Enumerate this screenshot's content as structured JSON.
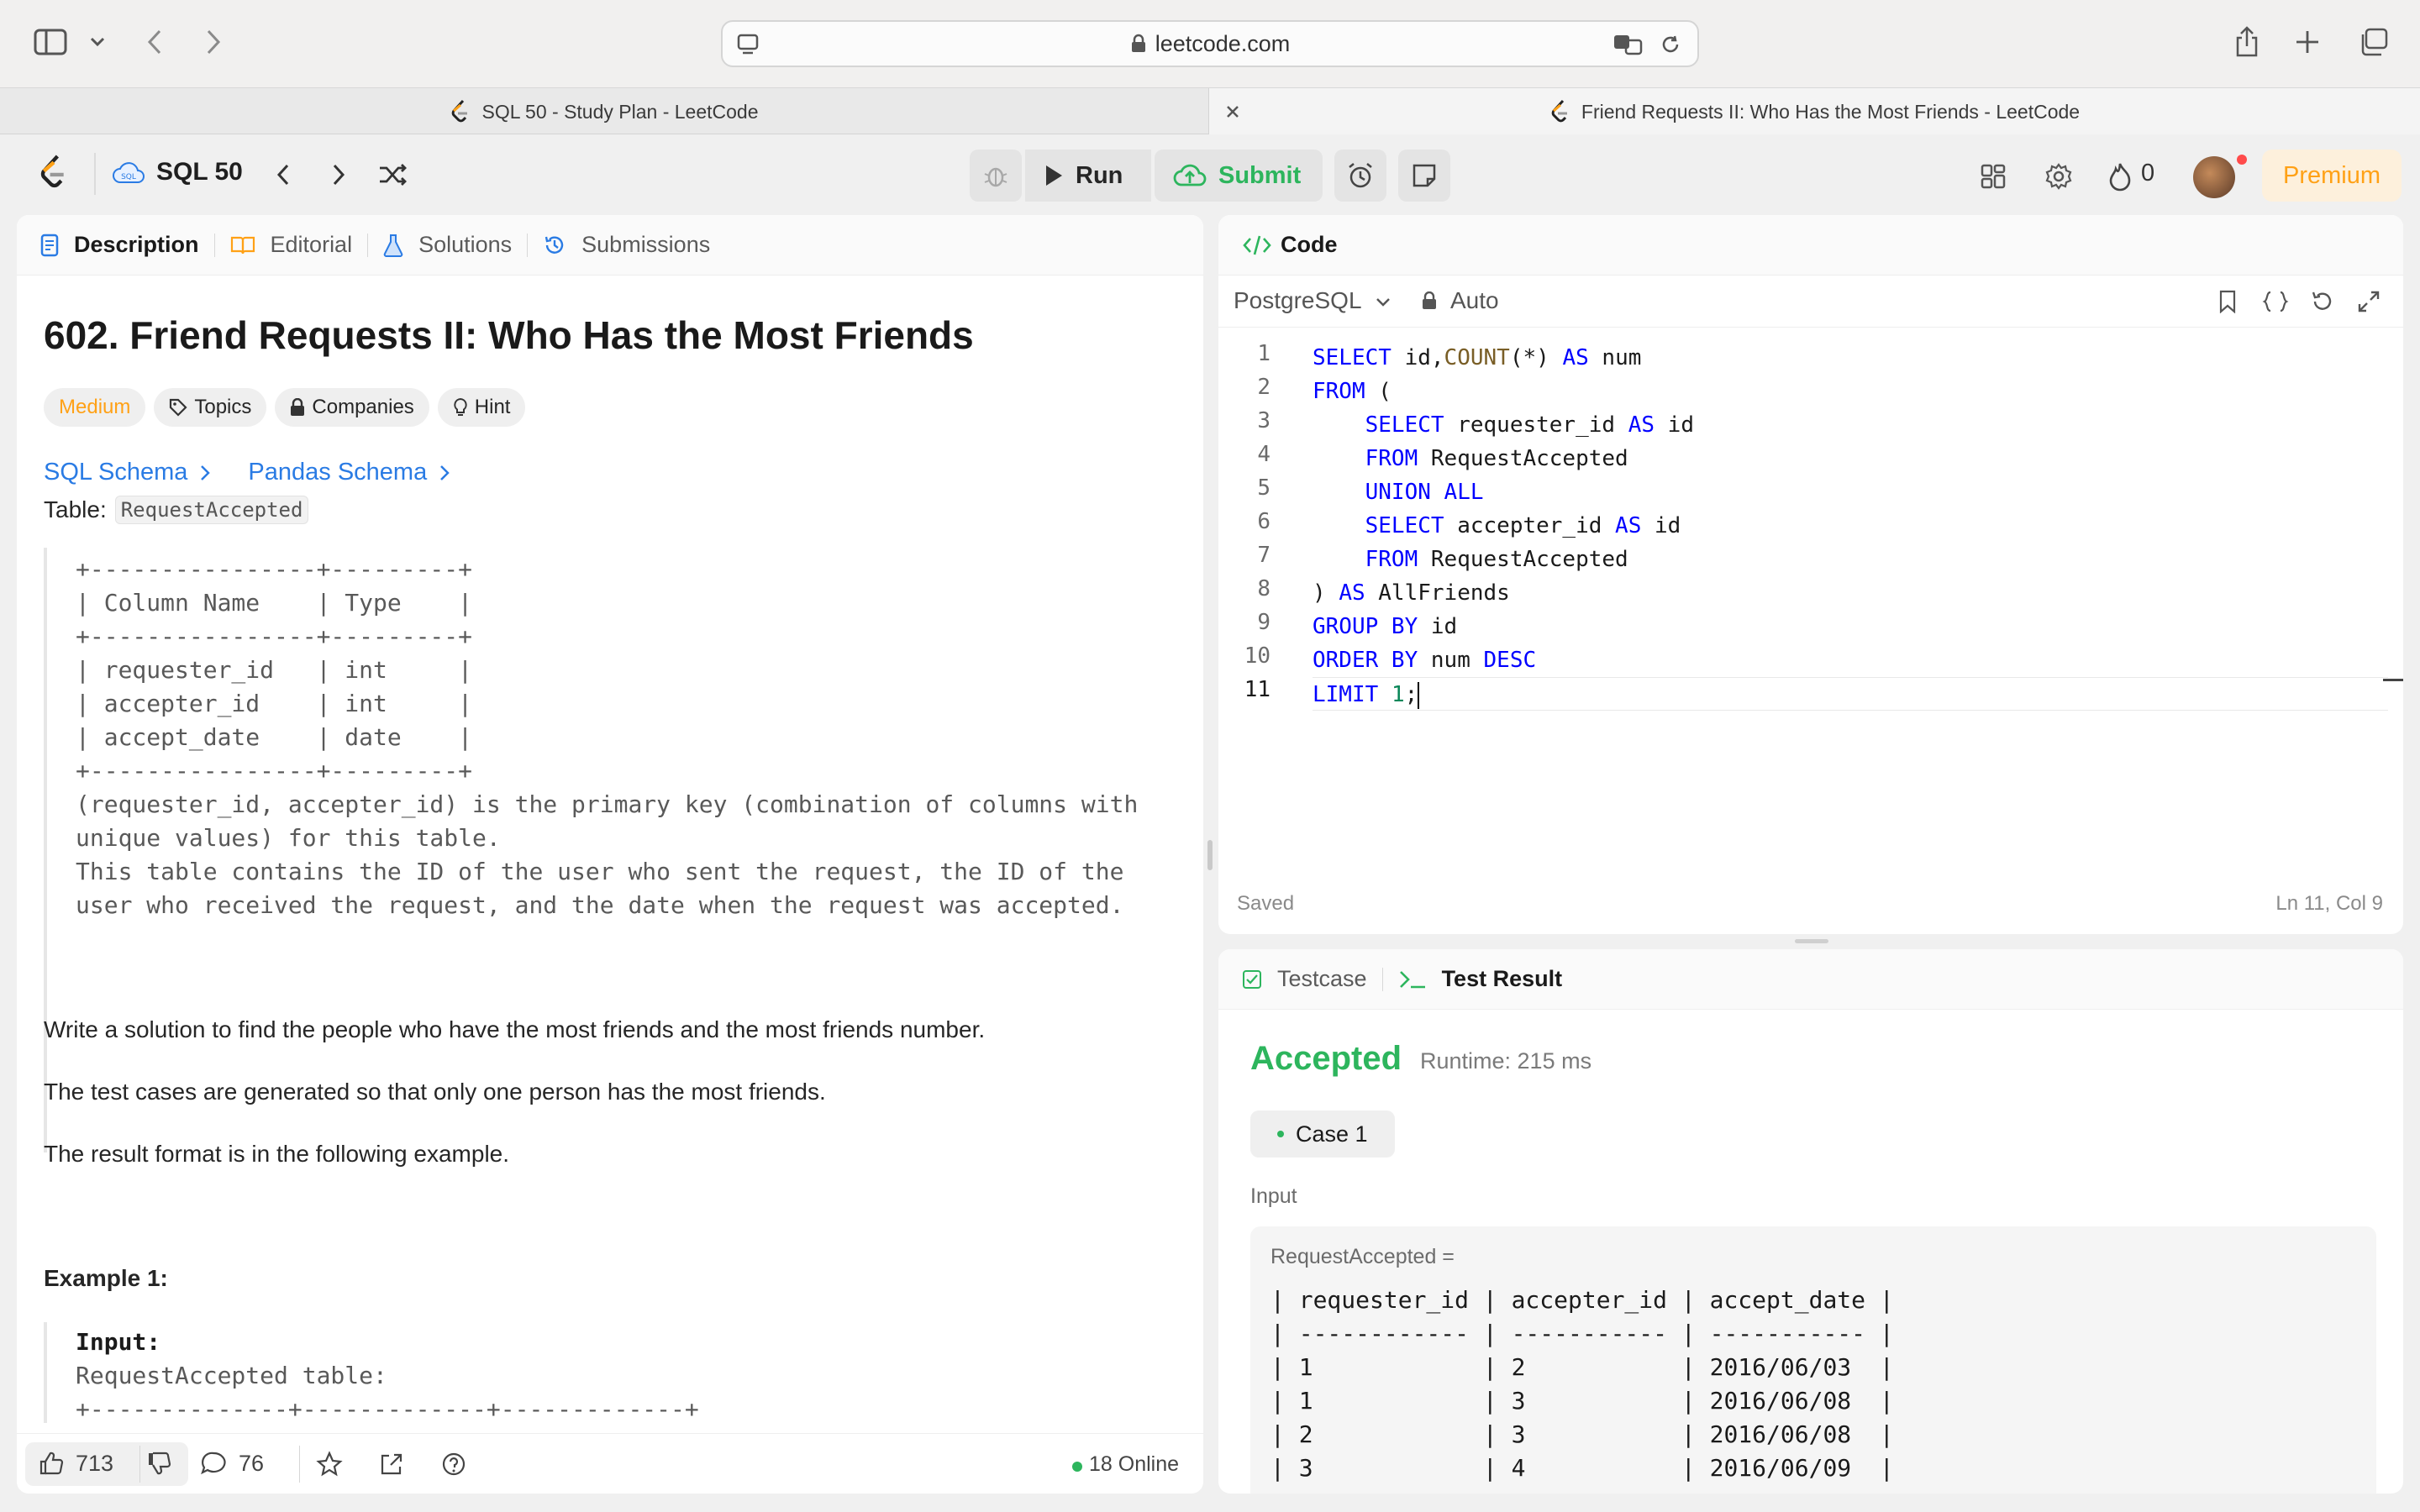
{
  "browser": {
    "url": "leetcode.com",
    "tabs": [
      {
        "title": "SQL 50 - Study Plan - LeetCode"
      },
      {
        "title": "Friend Requests II: Who Has the Most Friends - LeetCode"
      }
    ]
  },
  "nav": {
    "plan_name": "SQL 50",
    "run_label": "Run",
    "submit_label": "Submit",
    "streak_count": "0",
    "premium_label": "Premium"
  },
  "left_tabs": [
    "Description",
    "Editorial",
    "Solutions",
    "Submissions"
  ],
  "problem": {
    "title": "602. Friend Requests II: Who Has the Most Friends",
    "difficulty": "Medium",
    "chips": [
      "Topics",
      "Companies",
      "Hint"
    ],
    "schema_links": [
      "SQL Schema",
      "Pandas Schema"
    ],
    "table_label": "Table:",
    "table_name": "RequestAccepted",
    "schema_block": "+----------------+---------+\n| Column Name    | Type    |\n+----------------+---------+\n| requester_id   | int     |\n| accepter_id    | int     |\n| accept_date    | date    |\n+----------------+---------+\n(requester_id, accepter_id) is the primary key (combination of columns with\nunique values) for this table.\nThis table contains the ID of the user who sent the request, the ID of the\nuser who received the request, and the date when the request was accepted.",
    "paragraphs": [
      "Write a solution to find the people who have the most friends and the most friends number.",
      "The test cases are generated so that only one person has the most friends.",
      "The result format is in the following example."
    ],
    "example_heading": "Example 1:",
    "example_input_label": "Input:",
    "example_input_line": "RequestAccepted table:",
    "example_border": "+--------------+-------------+-------------+"
  },
  "footer": {
    "likes": "713",
    "comments": "76",
    "online": "18 Online"
  },
  "code_panel": {
    "title": "Code",
    "language": "PostgreSQL",
    "mode": "Auto",
    "saved": "Saved",
    "cursor": "Ln 11, Col 9",
    "line_numbers": [
      "1",
      "2",
      "3",
      "4",
      "5",
      "6",
      "7",
      "8",
      "9",
      "10",
      "11"
    ]
  },
  "result_panel": {
    "tabs": [
      "Testcase",
      "Test Result"
    ],
    "status": "Accepted",
    "runtime": "Runtime: 215 ms",
    "case_label": "Case 1",
    "input_label": "Input",
    "var_label": "RequestAccepted =",
    "table_lines": [
      "| requester_id | accepter_id | accept_date |",
      "| ------------ | ----------- | ----------- |",
      "| 1            | 2           | 2016/06/03  |",
      "| 1            | 3           | 2016/06/08  |",
      "| 2            | 3           | 2016/06/08  |",
      "| 3            | 4           | 2016/06/09  |"
    ]
  },
  "colors": {
    "accent_orange": "#ffa116",
    "accepted_green": "#2db55d",
    "link_blue": "#2a7be4",
    "submit_green": "#2db55d"
  }
}
